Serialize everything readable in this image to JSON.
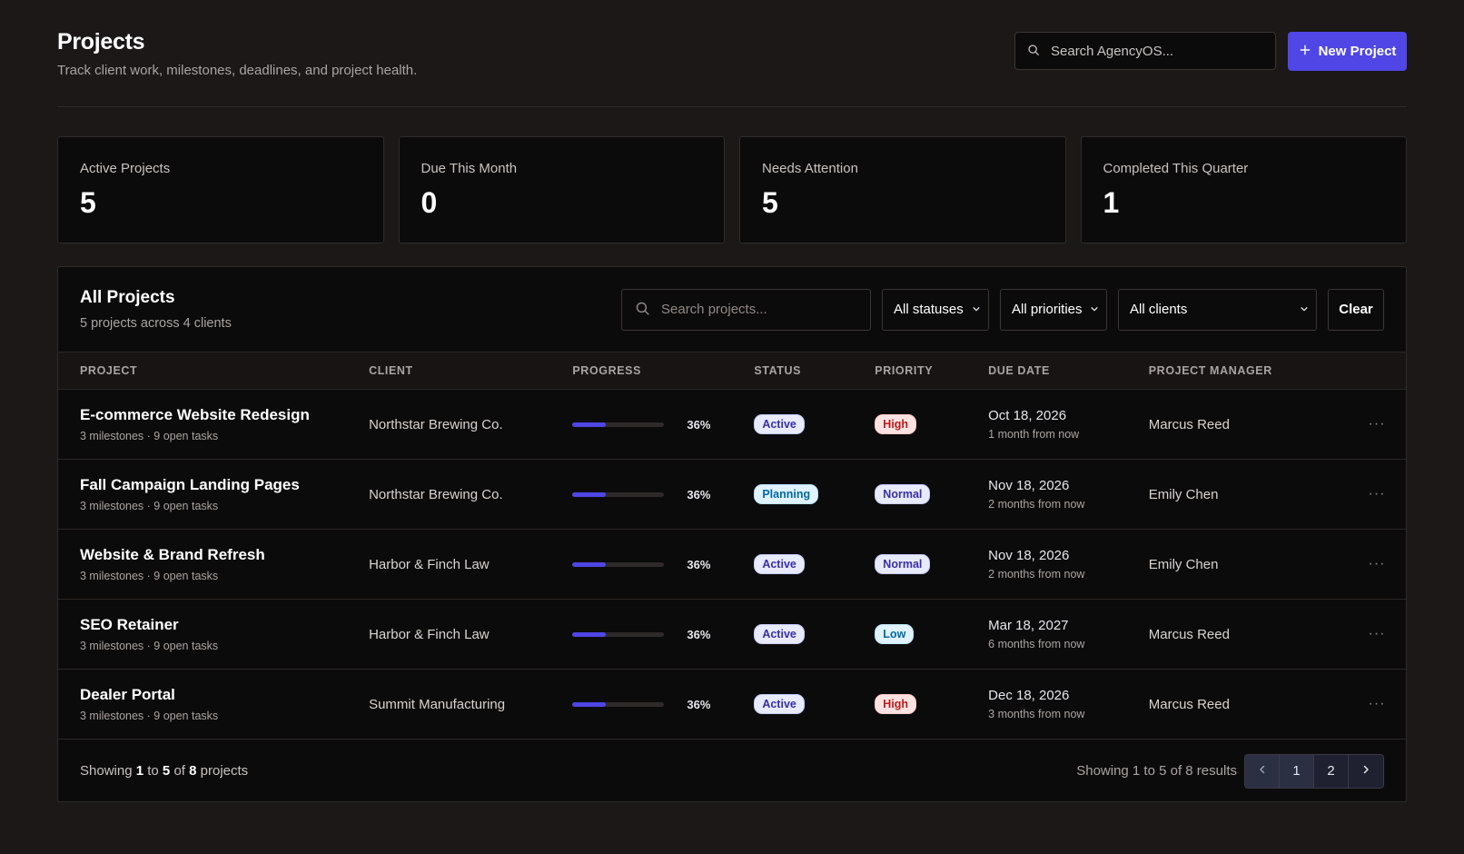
{
  "header": {
    "title": "Projects",
    "subtitle": "Track client work, milestones, deadlines, and project health.",
    "search_placeholder": "Search AgencyOS...",
    "new_project_label": "New Project"
  },
  "stats": [
    {
      "label": "Active Projects",
      "value": "5"
    },
    {
      "label": "Due This Month",
      "value": "0"
    },
    {
      "label": "Needs Attention",
      "value": "5"
    },
    {
      "label": "Completed This Quarter",
      "value": "1"
    }
  ],
  "panel": {
    "title": "All Projects",
    "subtitle": "5 projects across 4 clients",
    "search_placeholder": "Search projects...",
    "status_filter": "All statuses",
    "priority_filter": "All priorities",
    "client_filter": "All clients",
    "clear_label": "Clear"
  },
  "columns": [
    "PROJECT",
    "CLIENT",
    "PROGRESS",
    "STATUS",
    "PRIORITY",
    "DUE DATE",
    "PROJECT MANAGER"
  ],
  "rows": [
    {
      "name": "E-commerce Website Redesign",
      "meta": "3 milestones · 9 open tasks",
      "client": "Northstar Brewing Co.",
      "progress": 36,
      "progress_label": "36%",
      "status": "Active",
      "status_kind": "active",
      "priority": "High",
      "priority_kind": "high",
      "due": "Oct 18, 2026",
      "due_rel": "1 month from now",
      "pm": "Marcus Reed",
      "menu": "···"
    },
    {
      "name": "Fall Campaign Landing Pages",
      "meta": "3 milestones · 9 open tasks",
      "client": "Northstar Brewing Co.",
      "progress": 36,
      "progress_label": "36%",
      "status": "Planning",
      "status_kind": "planning",
      "priority": "Normal",
      "priority_kind": "normal",
      "due": "Nov 18, 2026",
      "due_rel": "2 months from now",
      "pm": "Emily Chen",
      "menu": "···"
    },
    {
      "name": "Website & Brand Refresh",
      "meta": "3 milestones · 9 open tasks",
      "client": "Harbor & Finch Law",
      "progress": 36,
      "progress_label": "36%",
      "status": "Active",
      "status_kind": "active",
      "priority": "Normal",
      "priority_kind": "normal",
      "due": "Nov 18, 2026",
      "due_rel": "2 months from now",
      "pm": "Emily Chen",
      "menu": "···"
    },
    {
      "name": "SEO Retainer",
      "meta": "3 milestones · 9 open tasks",
      "client": "Harbor & Finch Law",
      "progress": 36,
      "progress_label": "36%",
      "status": "Active",
      "status_kind": "active",
      "priority": "Low",
      "priority_kind": "low",
      "due": "Mar 18, 2027",
      "due_rel": "6 months from now",
      "pm": "Marcus Reed",
      "menu": "···"
    },
    {
      "name": "Dealer Portal",
      "meta": "3 milestones · 9 open tasks",
      "client": "Summit Manufacturing",
      "progress": 36,
      "progress_label": "36%",
      "status": "Active",
      "status_kind": "active",
      "priority": "High",
      "priority_kind": "high",
      "due": "Dec 18, 2026",
      "due_rel": "3 months from now",
      "pm": "Marcus Reed",
      "menu": "···"
    }
  ],
  "footer": {
    "showing_prefix": "Showing",
    "from": "1",
    "to_word": "to",
    "to": "5",
    "of_word": "of",
    "total": "8",
    "suffix": "projects",
    "results_text": "Showing 1 to 5 of 8 results",
    "pages": [
      "1",
      "2"
    ]
  },
  "colors": {
    "accent": "#4f46e5",
    "background": "#1b1817",
    "panel": "#0c0b0b"
  },
  "icons": {
    "search": "search-icon",
    "plus": "plus-icon",
    "chevron": "chevron-down-icon",
    "more": "more-icon",
    "prev": "chevron-left-icon",
    "next": "chevron-right-icon"
  }
}
